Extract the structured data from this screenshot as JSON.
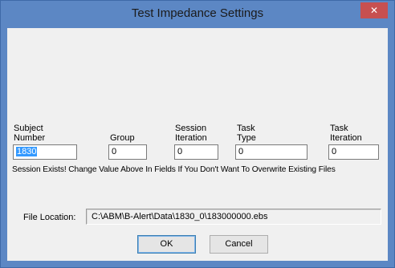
{
  "window": {
    "title": "Test Impedance Settings",
    "close_glyph": "✕"
  },
  "fields": {
    "subject_number": {
      "label_line1": "Subject",
      "label_line2": "Number",
      "value": "1830"
    },
    "group": {
      "label": "Group",
      "value": "0"
    },
    "session_iteration": {
      "label_line1": "Session",
      "label_line2": "Iteration",
      "value": "0"
    },
    "task_type": {
      "label_line1": "Task",
      "label_line2": "Type",
      "value": "0"
    },
    "task_iteration": {
      "label_line1": "Task",
      "label_line2": "Iteration",
      "value": "0"
    }
  },
  "warning": "Session Exists! Change Value Above In Fields If You Don't Want To Overwrite Existing Files",
  "file_location": {
    "label": "File Location:",
    "value": "C:\\ABM\\B-Alert\\Data\\1830_0\\183000000.ebs"
  },
  "buttons": {
    "ok": "OK",
    "cancel": "Cancel"
  },
  "colors": {
    "titlebar": "#5c87c4",
    "close_button": "#c75050",
    "selection": "#3399ff",
    "dialog_background": "#f0f0f0"
  }
}
